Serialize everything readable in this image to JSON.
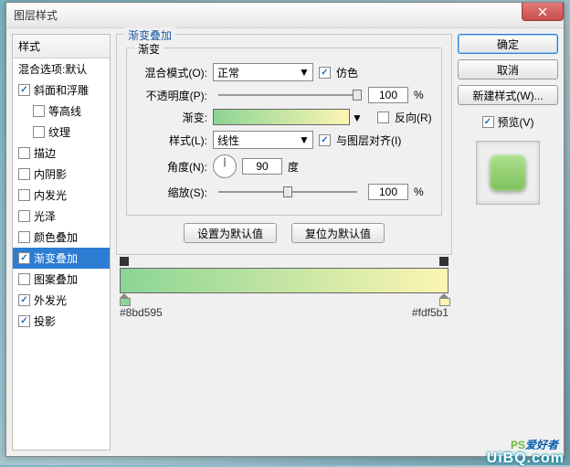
{
  "window": {
    "title": "图层样式"
  },
  "sidebar": {
    "header": "样式",
    "blend_defaults": "混合选项:默认",
    "items": [
      {
        "label": "斜面和浮雕",
        "checked": true
      },
      {
        "label": "等高线",
        "checked": false,
        "sub": true
      },
      {
        "label": "纹理",
        "checked": false,
        "sub": true
      },
      {
        "label": "描边",
        "checked": false
      },
      {
        "label": "内阴影",
        "checked": false
      },
      {
        "label": "内发光",
        "checked": false
      },
      {
        "label": "光泽",
        "checked": false
      },
      {
        "label": "颜色叠加",
        "checked": false
      },
      {
        "label": "渐变叠加",
        "checked": true,
        "selected": true
      },
      {
        "label": "图案叠加",
        "checked": false
      },
      {
        "label": "外发光",
        "checked": true
      },
      {
        "label": "投影",
        "checked": true
      }
    ]
  },
  "panel": {
    "title": "渐变叠加",
    "group": "渐变",
    "blend_mode_label": "混合模式(O):",
    "blend_mode_value": "正常",
    "dither_label": "仿色",
    "dither_checked": true,
    "opacity_label": "不透明度(P):",
    "opacity_value": "100",
    "opacity_unit": "%",
    "gradient_label": "渐变:",
    "reverse_label": "反向(R)",
    "reverse_checked": false,
    "style_label": "样式(L):",
    "style_value": "线性",
    "align_label": "与图层对齐(I)",
    "align_checked": true,
    "angle_label": "角度(N):",
    "angle_value": "90",
    "angle_unit": "度",
    "scale_label": "缩放(S):",
    "scale_value": "100",
    "scale_unit": "%",
    "btn_set_default": "设置为默认值",
    "btn_reset_default": "复位为默认值",
    "hex_left": "#8bd595",
    "hex_right": "#fdf5b1"
  },
  "buttons": {
    "ok": "确定",
    "cancel": "取消",
    "new_style": "新建样式(W)...",
    "preview": "预览(V)"
  },
  "watermark": {
    "ps": "PS",
    "txt": "爱好者",
    "site": "UiBQ.com"
  }
}
